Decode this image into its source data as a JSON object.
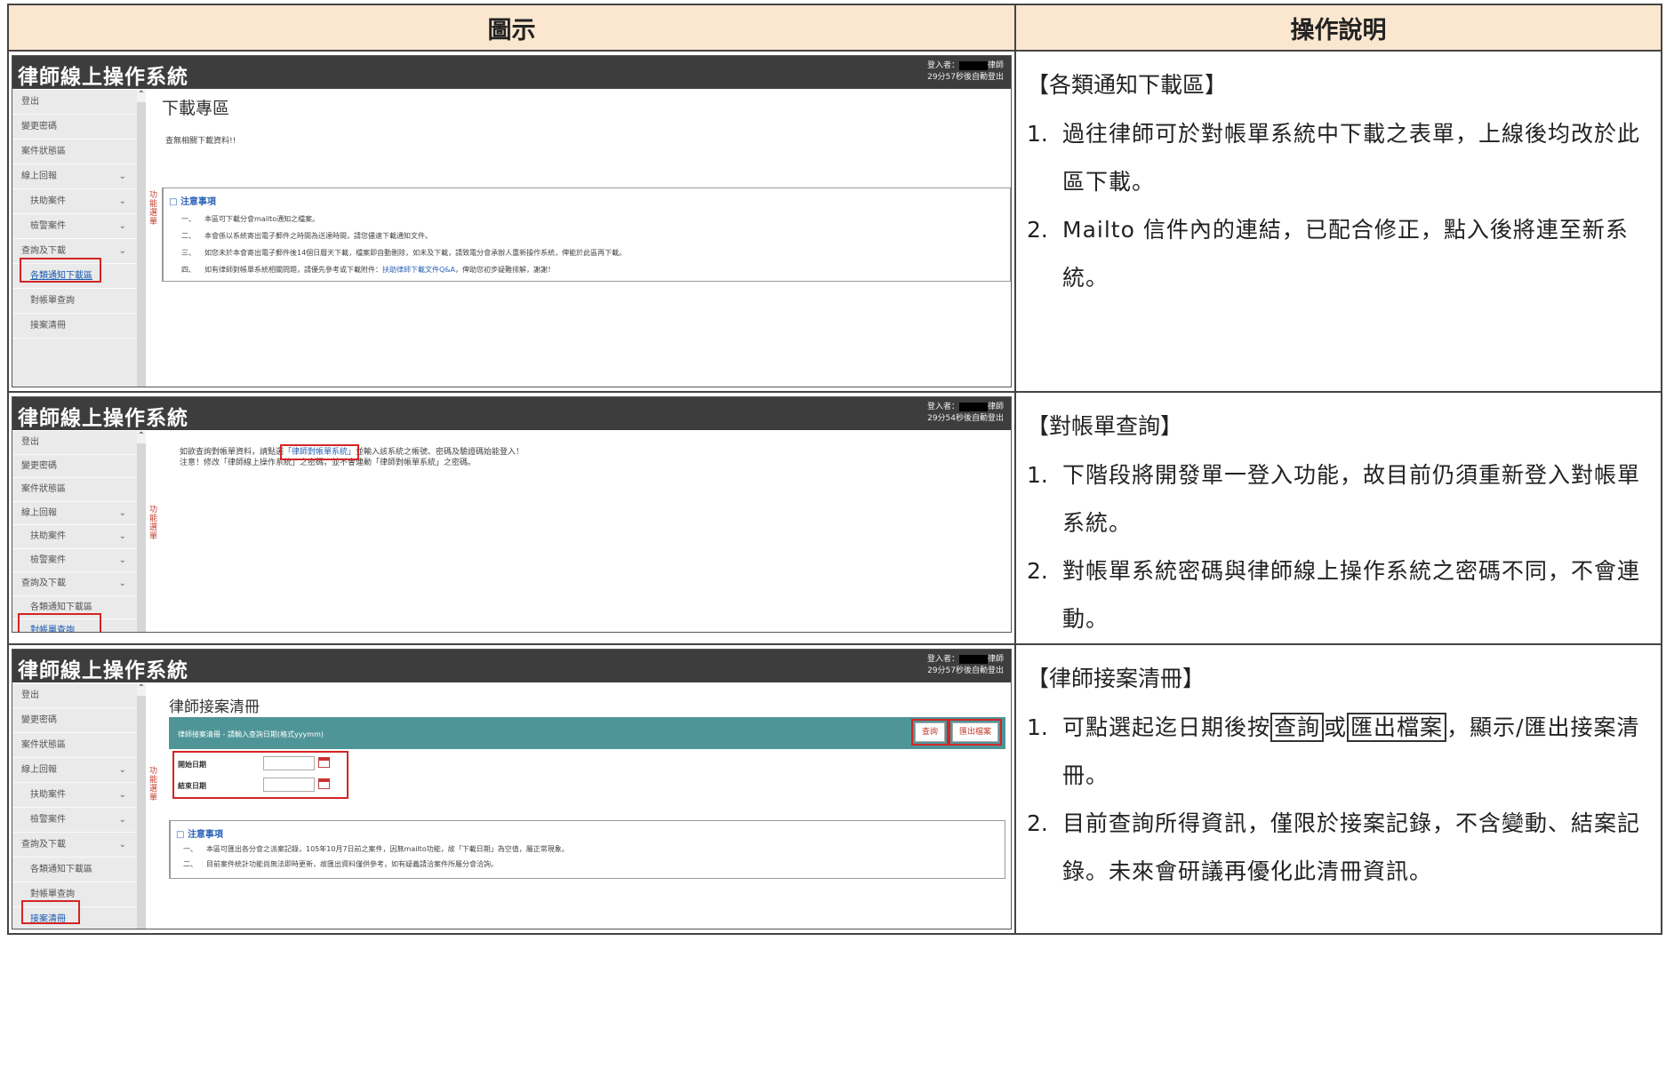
{
  "header": {
    "col1": "圖示",
    "col2": "操作說明"
  },
  "app": {
    "title": "律師線上操作系統",
    "user_label": "登入者：",
    "user_suffix": "律師"
  },
  "sidebar": {
    "logout": "登出",
    "change_password": "變更密碼",
    "case_status": "案件狀態區",
    "online_report": "線上回報",
    "aid_case": "扶助案件",
    "police_case": "檢警案件",
    "query_download": "查詢及下載",
    "notice_download": "各類通知下載區",
    "statement_query": "對帳單查詢",
    "case_list": "接案清冊"
  },
  "shot1": {
    "timer": "29分57秒後自動登出",
    "page_title": "下載專區",
    "empty_msg": "查無相關下載資料!!",
    "notice_title": "注意事項",
    "notices": [
      {
        "no": "一、",
        "text": "本區可下載分會mailto通知之檔案。"
      },
      {
        "no": "二、",
        "text": "本會係以系統寄出電子郵件之時間為送達時間，請您儘速下載通知文件。"
      },
      {
        "no": "三、",
        "text": "如您未於本會寄出電子郵件後14個日曆天下載，檔案即自動刪除，如未及下載，請致電分會承辦人重新操作系統，俾能於此區再下載。"
      },
      {
        "no": "四、",
        "text": "如有律師對帳單系統相關問題，請優先參考或下載附件：",
        "link": "扶助律師下載文件Q&A",
        "tail": "，俾助您初步疑難排解，謝謝！"
      }
    ]
  },
  "shot2": {
    "timer": "29分54秒後自動登出",
    "line1_pre": "如欲查詢對帳單資料，請點選",
    "line1_link": "「律師對帳單系統」",
    "line1_post": "並輸入該系統之帳號、密碼及驗證碼始能登入！",
    "line2": "注意！修改「律師線上操作系統」之密碼，並不會連動「律師對帳單系統」之密碼。"
  },
  "shot3": {
    "timer": "29分57秒後自動登出",
    "page_title": "律師接案清冊",
    "bar_text": "律師接案清冊 - 請輸入查詢日期(格式yyymm)",
    "query_btn": "查詢",
    "export_btn": "匯出檔案",
    "start_date": "開始日期",
    "end_date": "結束日期",
    "notice_title": "注意事項",
    "notices": [
      {
        "no": "一、",
        "text": "本區可匯出各分會之派案記錄，105年10月7日前之案件，因無mailto功能，故「下載日期」為空值，屬正常現象。"
      },
      {
        "no": "二、",
        "text": "目前案件統計功能尚無法即時更新，故匯出資料僅供參考，如有疑義請洽案件所屬分會洽詢。"
      }
    ]
  },
  "desc1": {
    "heading": "【各類通知下載區】",
    "items": [
      {
        "num": "1.",
        "text": "過往律師可於對帳單系統中下載之表單，上線後均改於此區下載。"
      },
      {
        "num": "2.",
        "text": "Mailto 信件內的連結，已配合修正，點入後將連至新系統。"
      }
    ]
  },
  "desc2": {
    "heading": "【對帳單查詢】",
    "items": [
      {
        "num": "1.",
        "text": "下階段將開發單一登入功能，故目前仍須重新登入對帳單系統。"
      },
      {
        "num": "2.",
        "text": "對帳單系統密碼與律師線上操作系統之密碼不同，不會連動。"
      }
    ]
  },
  "desc3": {
    "heading": "【律師接案清冊】",
    "item1_pre": "可點選起迄日期後按",
    "item1_b1": "查詢",
    "item1_mid": "或",
    "item1_b2": "匯出檔案",
    "item1_post": "，顯示/匯出接案清冊。",
    "item2": "目前查詢所得資訊，僅限於接案記錄，不含變動、結案記錄。未來會研議再優化此清冊資訊。",
    "num1": "1.",
    "num2": "2."
  },
  "vtab_text": "功能選單"
}
